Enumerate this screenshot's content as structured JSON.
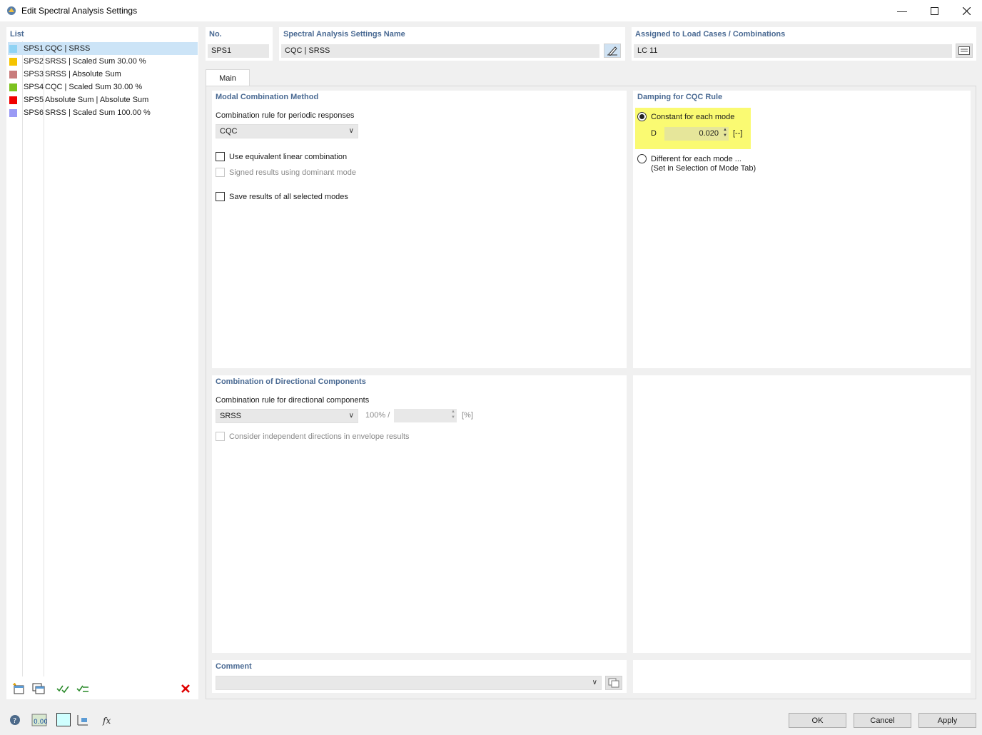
{
  "window": {
    "title": "Edit Spectral Analysis Settings"
  },
  "list": {
    "title": "List",
    "items": [
      {
        "no": "SPS1",
        "name": "CQC | SRSS",
        "color": "#8fd3f4",
        "selected": true
      },
      {
        "no": "SPS2",
        "name": "SRSS | Scaled Sum 30.00 %",
        "color": "#f5c400"
      },
      {
        "no": "SPS3",
        "name": "SRSS | Absolute Sum",
        "color": "#c97c7c"
      },
      {
        "no": "SPS4",
        "name": "CQC | Scaled Sum 30.00 %",
        "color": "#7cc21f"
      },
      {
        "no": "SPS5",
        "name": "Absolute Sum | Absolute Sum",
        "color": "#f00000"
      },
      {
        "no": "SPS6",
        "name": "SRSS | Scaled Sum 100.00 %",
        "color": "#9a9af5"
      }
    ]
  },
  "header": {
    "no_label": "No.",
    "no_value": "SPS1",
    "name_label": "Spectral Analysis Settings Name",
    "name_value": "CQC | SRSS",
    "assigned_label": "Assigned to Load Cases / Combinations",
    "assigned_value": "LC 11"
  },
  "tabs": [
    {
      "label": "Main"
    }
  ],
  "modal": {
    "title": "Modal Combination Method",
    "rule_label": "Combination rule for periodic responses",
    "rule_value": "CQC",
    "equiv_label": "Use equivalent linear combination",
    "signed_label": "Signed results using dominant mode",
    "save_label": "Save results of all selected modes"
  },
  "damping": {
    "title": "Damping for CQC Rule",
    "constant_label": "Constant for each mode",
    "d_label": "D",
    "d_value": "0.020",
    "d_unit": "[--]",
    "different_label": "Different for each mode ...",
    "different_sub": "(Set in Selection of Mode Tab)"
  },
  "directional": {
    "title": "Combination of Directional Components",
    "rule_label": "Combination rule for directional components",
    "rule_value": "SRSS",
    "pct_label": "100% /",
    "unit": "[%]",
    "consider_label": "Consider independent directions in envelope results"
  },
  "comment": {
    "title": "Comment"
  },
  "buttons": {
    "ok": "OK",
    "cancel": "Cancel",
    "apply": "Apply"
  }
}
